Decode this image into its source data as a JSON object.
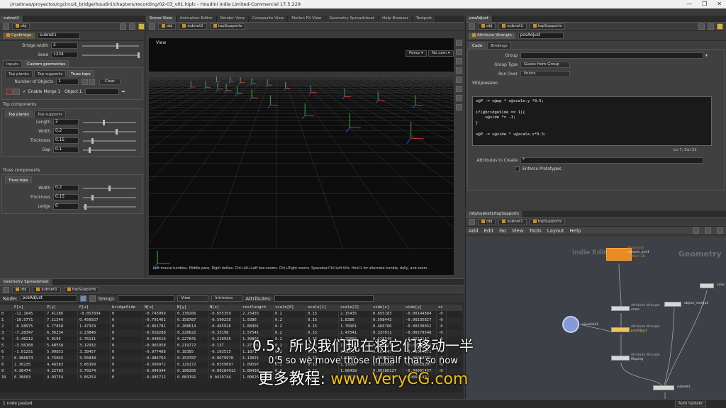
{
  "window": {
    "title": "//rushnas/proyectos/cgcircuit_bridge/houdini/chapters/recording/02-03_v01.hiplc - Houdini Indie Limited-Commercial 17.5.229",
    "controls": [
      "—",
      "❐",
      "✕"
    ]
  },
  "left": {
    "tab": "subnet1",
    "path": "obj",
    "node_type": "CgcBridge",
    "node_name": "subnet1",
    "params": [
      {
        "label": "Bridge width",
        "value": "2"
      },
      {
        "label": "Seed",
        "value": "1234"
      }
    ],
    "tabs1": [
      "Inputs",
      "Custom geometries"
    ],
    "tabs2": [
      "Top planks",
      "Top supports",
      "Truss tops"
    ],
    "num_objects": {
      "label": "Number of Objects",
      "value": "1",
      "clear": "Clear"
    },
    "enable_merge": "Enable Merge 1",
    "object_label": "Object 1",
    "top_components": "Top components",
    "tabs3": [
      "Top planks",
      "Top supports"
    ],
    "top_params": [
      {
        "label": "Length",
        "value": "2"
      },
      {
        "label": "Width",
        "value": "0.2"
      },
      {
        "label": "Thickness",
        "value": "0.15"
      },
      {
        "label": "Gap",
        "value": "0.1"
      }
    ],
    "truss_components": "Truss components",
    "tabs4": [
      "Truss tops"
    ],
    "truss_params": [
      {
        "label": "Width",
        "value": "0.2"
      },
      {
        "label": "Thickness",
        "value": "0.15"
      },
      {
        "label": "Ledge",
        "value": "0"
      }
    ]
  },
  "viewer": {
    "tabs": [
      "Scene View",
      "Animation Editor",
      "Render View",
      "Composite View",
      "Motion FX View",
      "Geometry Spreadsheet",
      "Help Browser",
      "Textport"
    ],
    "path": [
      "obj",
      "subnet1",
      "topSupports"
    ],
    "label": "View",
    "persp": "Persp ▾",
    "cam": "No cam ▾",
    "hint": "Left mouse tumbles. Middle pans. Right dollies. Ctrl+Alt+Left box-zooms. Ctrl+Right zooms. Spacebar-Ctrl-Left tilts. Hold L for alternate tumble, dolly, and zoom."
  },
  "spreadsheet": {
    "tab": "Geometry Spreadsheet",
    "path": [
      "obj",
      "subnet1",
      "topSupports"
    ],
    "node_label": "Node:",
    "node_value": "posAdjust",
    "group_label": "Group:",
    "view_label": "View",
    "intrinsics": "Intrinsics",
    "attributes": "Attributes:",
    "columns": [
      "",
      "P[x]",
      "P[y]",
      "P[z]",
      "bridgeSide",
      "N[x]",
      "N[y]",
      "N[z]",
      "restlength",
      "scale[0]",
      "scale[1]",
      "scale[2]",
      "side[x]",
      "side[y]",
      "si"
    ],
    "rows": [
      [
        "0",
        "-12.1645",
        "7.41286",
        "-8.857834",
        "0",
        "-0.743999",
        "0.130266",
        "-0.655359",
        "2.25435",
        "0.2",
        "0.15",
        "2.15435",
        "0.655183",
        "-0.00144884",
        "-0"
      ],
      [
        "1",
        "-10.5771",
        "7.11249",
        "0.456027",
        "0",
        "-0.791461",
        "0.158787",
        "-0.590235",
        "1.9386",
        "0.2",
        "0.15",
        "1.8386",
        "0.598443",
        "-0.00235827",
        "-0"
      ],
      [
        "2",
        "-8.98975",
        "6.77858",
        "1.47329",
        "0",
        "-0.861781",
        "0.208614",
        "-0.465926",
        "1.88901",
        "0.2",
        "0.15",
        "1.78901",
        "0.466706",
        "-0.00230052",
        "-0"
      ],
      [
        "3",
        "-7.28347",
        "6.36234",
        "2.23846",
        "0",
        "-0.918288",
        "0.228622",
        "-0.33198",
        "1.57541",
        "0.2",
        "0.15",
        "1.47541",
        "0.337011",
        "-0.00179548",
        "-0"
      ],
      [
        "4",
        "-5.46212",
        "5.9195",
        "2.76111",
        "0",
        "-0.948516",
        "0.227841",
        "-0.219935",
        "1.39866",
        "0.2",
        "0.15",
        "1.29866",
        "0.225549",
        "-0.0012147",
        "-0"
      ],
      [
        "5",
        "-3.56168",
        "5.48558",
        "3.12932",
        "0",
        "-0.965958",
        "0.219772",
        "-0.137",
        "1.27301",
        "0.2",
        "0.15",
        "1.17301",
        "0.135211",
        "-0.00076301",
        "-0"
      ],
      [
        "6",
        "-1.61251",
        "5.09853",
        "3.38457",
        "0",
        "-0.977488",
        "0.18385",
        "-0.103515",
        "1.1871",
        "0.2",
        "0.15",
        "1.0871",
        "0.105847",
        "-0.00054871",
        "-0"
      ],
      [
        "7",
        "0.366874",
        "4.75045",
        "3.55838",
        "0",
        "-0.985762",
        "0.153787",
        "-0.0679978",
        "1.13021",
        "0.2",
        "0.15",
        "1.03021",
        "0.0682321",
        "-0.00034781",
        "-0"
      ],
      [
        "8",
        "2.36235",
        "4.46583",
        "3.66399",
        "0",
        "-0.990972",
        "0.129172",
        "-0.0359097",
        "1.09597",
        "0.2",
        "0.15",
        "1.19597",
        "0.0359597",
        "-0.00018297",
        "-0"
      ],
      [
        "9",
        "4.36474",
        "4.22783",
        "3.70174",
        "0",
        "-0.994344",
        "0.106205",
        "-0.00284912",
        "1.08438",
        "0.2",
        "0.15",
        "1.08438",
        "0.00286127",
        "-0.00001457",
        "-0"
      ],
      [
        "10",
        "6.36603",
        "4.03754",
        "3.66254",
        "0",
        "-0.995712",
        "0.083191",
        "0.0419744",
        "1.09625",
        "0.2",
        "0.15",
        "1.09625",
        "-0.0421559",
        "0.00021492",
        "-0"
      ]
    ]
  },
  "status": {
    "text": "1 node pasted",
    "auto_update": "Auto Update"
  },
  "wrangle": {
    "tab": "posAdjust",
    "path": [
      "obj",
      "subnet1",
      "topSupports"
    ],
    "node_type": "Attribute Wrangle",
    "node_name": "posAdjust",
    "tabs": [
      "Code",
      "Bindings"
    ],
    "group_label": "Group",
    "group_value": "",
    "group_type_label": "Group Type",
    "group_type_value": "Guess from Group",
    "run_over_label": "Run Over",
    "run_over_value": "Points",
    "vex_label": "VEXpression",
    "code": [
      "v@P -= v@up * v@scale.y *0.5;",
      "",
      "if(@bridgeSide == 1){",
      "    v@side *= -1;",
      "}",
      "",
      "v@P -= v@side * v@scale.x*0.5;"
    ],
    "cursor": "Ln 7, Col 31",
    "attr_create_label": "Attributes to Create",
    "attr_create_value": "*",
    "enforce": "Enforce Prototypes"
  },
  "network": {
    "tab": "/obj/subnet1/topSupports",
    "path": [
      "obj",
      "subnet1",
      "topSupports"
    ],
    "menu": [
      "Add",
      "Edit",
      "Go",
      "View",
      "Tools",
      "Layout",
      "Help"
    ],
    "watermark_left": "Indie Edition",
    "watermark_right": "Geometry",
    "nodes": [
      {
        "name": "foreach_end1",
        "type": "Block End",
        "sub": "Gather: 28"
      },
      {
        "name": "color",
        "type": ""
      },
      {
        "name": "object_merge2",
        "type": ""
      },
      {
        "name": "scale",
        "type": "Attribute Wrangle"
      },
      {
        "name": "posAdjust",
        "type": "Attribute Wrangle"
      },
      {
        "name": "visualize1",
        "type": ""
      },
      {
        "name": "flipping",
        "type": "Attribute Wrangle"
      },
      {
        "name": "subnet1",
        "type": ""
      },
      {
        "name": "OUT",
        "type": "Null"
      }
    ]
  },
  "subtitles": {
    "zh": "0.5，所以我们现在将它们移动一半",
    "en": "0.5 so we move those in half that so now",
    "promo_prefix": "更多教程:",
    "promo_url": "www.VeryCG.com"
  }
}
